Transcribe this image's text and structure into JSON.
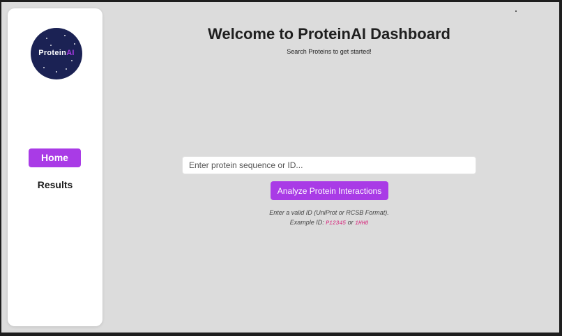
{
  "sidebar": {
    "logo": {
      "text_main": "Protein",
      "text_accent": "AI",
      "background": "#1b2254",
      "accent_color": "#a93be6"
    },
    "nav": {
      "home_label": "Home",
      "results_label": "Results"
    }
  },
  "main": {
    "title": "Welcome to ProteinAI Dashboard",
    "subtitle": "Search Proteins to get started!",
    "search": {
      "placeholder": "Enter protein sequence or ID...",
      "value": ""
    },
    "analyze_button_label": "Analyze Protein Interactions",
    "hint": {
      "line1": "Enter a valid ID (UniProt or RCSB Format).",
      "line2_prefix": "Example ID:",
      "example1": "P12345",
      "separator": "or",
      "example2": "1HH0"
    }
  },
  "colors": {
    "accent": "#a93be6",
    "page_background": "#dcdcdc",
    "example_id_color": "#d6247a"
  }
}
